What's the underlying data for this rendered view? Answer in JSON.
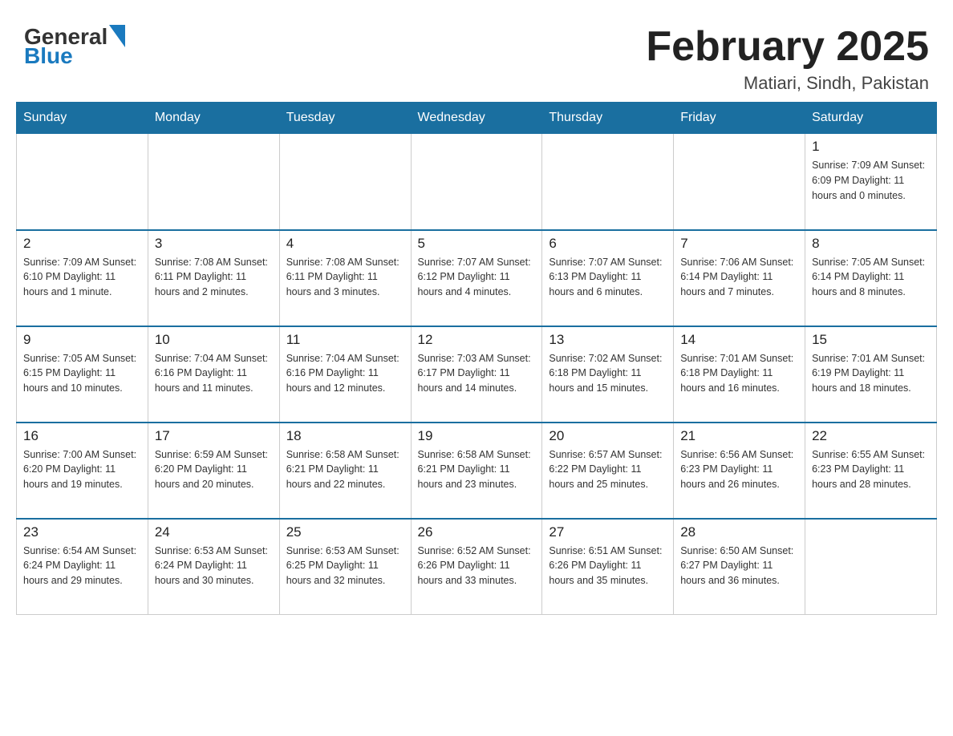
{
  "header": {
    "logo_general": "General",
    "logo_blue": "Blue",
    "month_title": "February 2025",
    "location": "Matiari, Sindh, Pakistan"
  },
  "weekdays": [
    "Sunday",
    "Monday",
    "Tuesday",
    "Wednesday",
    "Thursday",
    "Friday",
    "Saturday"
  ],
  "weeks": [
    [
      {
        "day": "",
        "info": ""
      },
      {
        "day": "",
        "info": ""
      },
      {
        "day": "",
        "info": ""
      },
      {
        "day": "",
        "info": ""
      },
      {
        "day": "",
        "info": ""
      },
      {
        "day": "",
        "info": ""
      },
      {
        "day": "1",
        "info": "Sunrise: 7:09 AM\nSunset: 6:09 PM\nDaylight: 11 hours\nand 0 minutes."
      }
    ],
    [
      {
        "day": "2",
        "info": "Sunrise: 7:09 AM\nSunset: 6:10 PM\nDaylight: 11 hours\nand 1 minute."
      },
      {
        "day": "3",
        "info": "Sunrise: 7:08 AM\nSunset: 6:11 PM\nDaylight: 11 hours\nand 2 minutes."
      },
      {
        "day": "4",
        "info": "Sunrise: 7:08 AM\nSunset: 6:11 PM\nDaylight: 11 hours\nand 3 minutes."
      },
      {
        "day": "5",
        "info": "Sunrise: 7:07 AM\nSunset: 6:12 PM\nDaylight: 11 hours\nand 4 minutes."
      },
      {
        "day": "6",
        "info": "Sunrise: 7:07 AM\nSunset: 6:13 PM\nDaylight: 11 hours\nand 6 minutes."
      },
      {
        "day": "7",
        "info": "Sunrise: 7:06 AM\nSunset: 6:14 PM\nDaylight: 11 hours\nand 7 minutes."
      },
      {
        "day": "8",
        "info": "Sunrise: 7:05 AM\nSunset: 6:14 PM\nDaylight: 11 hours\nand 8 minutes."
      }
    ],
    [
      {
        "day": "9",
        "info": "Sunrise: 7:05 AM\nSunset: 6:15 PM\nDaylight: 11 hours\nand 10 minutes."
      },
      {
        "day": "10",
        "info": "Sunrise: 7:04 AM\nSunset: 6:16 PM\nDaylight: 11 hours\nand 11 minutes."
      },
      {
        "day": "11",
        "info": "Sunrise: 7:04 AM\nSunset: 6:16 PM\nDaylight: 11 hours\nand 12 minutes."
      },
      {
        "day": "12",
        "info": "Sunrise: 7:03 AM\nSunset: 6:17 PM\nDaylight: 11 hours\nand 14 minutes."
      },
      {
        "day": "13",
        "info": "Sunrise: 7:02 AM\nSunset: 6:18 PM\nDaylight: 11 hours\nand 15 minutes."
      },
      {
        "day": "14",
        "info": "Sunrise: 7:01 AM\nSunset: 6:18 PM\nDaylight: 11 hours\nand 16 minutes."
      },
      {
        "day": "15",
        "info": "Sunrise: 7:01 AM\nSunset: 6:19 PM\nDaylight: 11 hours\nand 18 minutes."
      }
    ],
    [
      {
        "day": "16",
        "info": "Sunrise: 7:00 AM\nSunset: 6:20 PM\nDaylight: 11 hours\nand 19 minutes."
      },
      {
        "day": "17",
        "info": "Sunrise: 6:59 AM\nSunset: 6:20 PM\nDaylight: 11 hours\nand 20 minutes."
      },
      {
        "day": "18",
        "info": "Sunrise: 6:58 AM\nSunset: 6:21 PM\nDaylight: 11 hours\nand 22 minutes."
      },
      {
        "day": "19",
        "info": "Sunrise: 6:58 AM\nSunset: 6:21 PM\nDaylight: 11 hours\nand 23 minutes."
      },
      {
        "day": "20",
        "info": "Sunrise: 6:57 AM\nSunset: 6:22 PM\nDaylight: 11 hours\nand 25 minutes."
      },
      {
        "day": "21",
        "info": "Sunrise: 6:56 AM\nSunset: 6:23 PM\nDaylight: 11 hours\nand 26 minutes."
      },
      {
        "day": "22",
        "info": "Sunrise: 6:55 AM\nSunset: 6:23 PM\nDaylight: 11 hours\nand 28 minutes."
      }
    ],
    [
      {
        "day": "23",
        "info": "Sunrise: 6:54 AM\nSunset: 6:24 PM\nDaylight: 11 hours\nand 29 minutes."
      },
      {
        "day": "24",
        "info": "Sunrise: 6:53 AM\nSunset: 6:24 PM\nDaylight: 11 hours\nand 30 minutes."
      },
      {
        "day": "25",
        "info": "Sunrise: 6:53 AM\nSunset: 6:25 PM\nDaylight: 11 hours\nand 32 minutes."
      },
      {
        "day": "26",
        "info": "Sunrise: 6:52 AM\nSunset: 6:26 PM\nDaylight: 11 hours\nand 33 minutes."
      },
      {
        "day": "27",
        "info": "Sunrise: 6:51 AM\nSunset: 6:26 PM\nDaylight: 11 hours\nand 35 minutes."
      },
      {
        "day": "28",
        "info": "Sunrise: 6:50 AM\nSunset: 6:27 PM\nDaylight: 11 hours\nand 36 minutes."
      },
      {
        "day": "",
        "info": ""
      }
    ]
  ]
}
